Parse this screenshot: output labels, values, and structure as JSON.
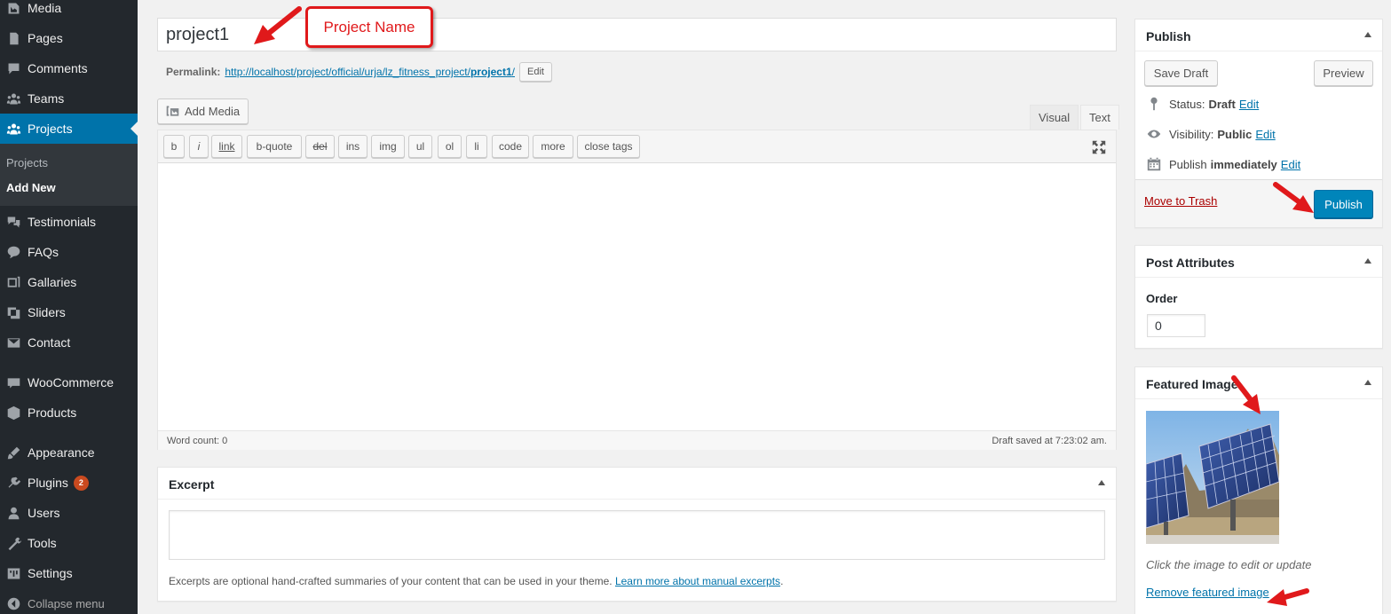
{
  "sidebar": {
    "items": [
      {
        "label": "Media",
        "icon": "media-icon"
      },
      {
        "label": "Pages",
        "icon": "pages-icon"
      },
      {
        "label": "Comments",
        "icon": "comments-icon"
      },
      {
        "label": "Teams",
        "icon": "teams-icon"
      },
      {
        "label": "Projects",
        "icon": "projects-icon"
      },
      {
        "label": "Testimonials",
        "icon": "testimonials-icon"
      },
      {
        "label": "FAQs",
        "icon": "faqs-icon"
      },
      {
        "label": "Gallaries",
        "icon": "gallaries-icon"
      },
      {
        "label": "Sliders",
        "icon": "sliders-icon"
      },
      {
        "label": "Contact",
        "icon": "contact-icon"
      },
      {
        "label": "WooCommerce",
        "icon": "woocommerce-icon"
      },
      {
        "label": "Products",
        "icon": "products-icon"
      },
      {
        "label": "Appearance",
        "icon": "appearance-icon"
      },
      {
        "label": "Plugins",
        "icon": "plugins-icon",
        "badge": "2"
      },
      {
        "label": "Users",
        "icon": "users-icon"
      },
      {
        "label": "Tools",
        "icon": "tools-icon"
      },
      {
        "label": "Settings",
        "icon": "settings-icon"
      }
    ],
    "submenu": {
      "projects": "Projects",
      "add_new": "Add New"
    },
    "collapse": "Collapse menu"
  },
  "editor": {
    "title_value": "project1",
    "permalink_label": "Permalink:",
    "permalink_base": "http://localhost/project/official/urja/lz_fitness_project/",
    "permalink_slug": "project1",
    "permalink_suffix": "/",
    "edit_label": "Edit",
    "add_media": "Add Media",
    "tabs": {
      "visual": "Visual",
      "text": "Text"
    },
    "quicktags": [
      "b",
      "i",
      "link",
      "b-quote",
      "del",
      "ins",
      "img",
      "ul",
      "ol",
      "li",
      "code",
      "more",
      "close tags"
    ],
    "word_count": "Word count: 0",
    "draft_saved": "Draft saved at 7:23:02 am."
  },
  "excerpt": {
    "title": "Excerpt",
    "help_text": "Excerpts are optional hand-crafted summaries of your content that can be used in your theme.",
    "help_link": "Learn more about manual excerpts",
    "help_end": "."
  },
  "publish": {
    "title": "Publish",
    "save_draft": "Save Draft",
    "preview": "Preview",
    "status_label": "Status:",
    "status_value": "Draft",
    "visibility_label": "Visibility:",
    "visibility_value": "Public",
    "publish_label": "Publish",
    "publish_value": "immediately",
    "edit": "Edit",
    "trash": "Move to Trash",
    "publish_button": "Publish"
  },
  "post_attributes": {
    "title": "Post Attributes",
    "order_label": "Order",
    "order_value": "0"
  },
  "featured_image": {
    "title": "Featured Image",
    "caption": "Click the image to edit or update",
    "remove": "Remove featured image"
  },
  "annotations": {
    "callout": "Project Name"
  },
  "colors": {
    "sidebar_bg": "#23282d",
    "active_bg": "#0073aa",
    "link": "#0073aa",
    "primary_button": "#0085ba",
    "annotation_red": "#e0191b"
  }
}
